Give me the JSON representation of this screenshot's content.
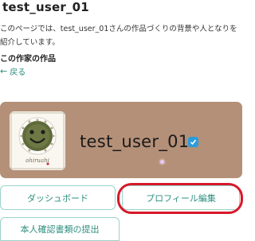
{
  "header": {
    "title": "test_user_01",
    "description": "このページでは、test_user_01さんの作品づくりの背景や人となりを紹介しています。"
  },
  "works_section": {
    "label": "この作家の作品",
    "back_label": "戻る",
    "back_icon": "arrow-left-icon"
  },
  "profile": {
    "username": "test_user_01",
    "verified": true,
    "avatar_caption": "ohiruahi",
    "card_color": "#b49078",
    "badge_color": "#2d9cdb"
  },
  "actions": {
    "dashboard_label": "ダッシュボード",
    "edit_profile_label": "プロフィール編集",
    "submit_id_label": "本人確認書類の提出",
    "highlight_color": "#d7192a"
  }
}
